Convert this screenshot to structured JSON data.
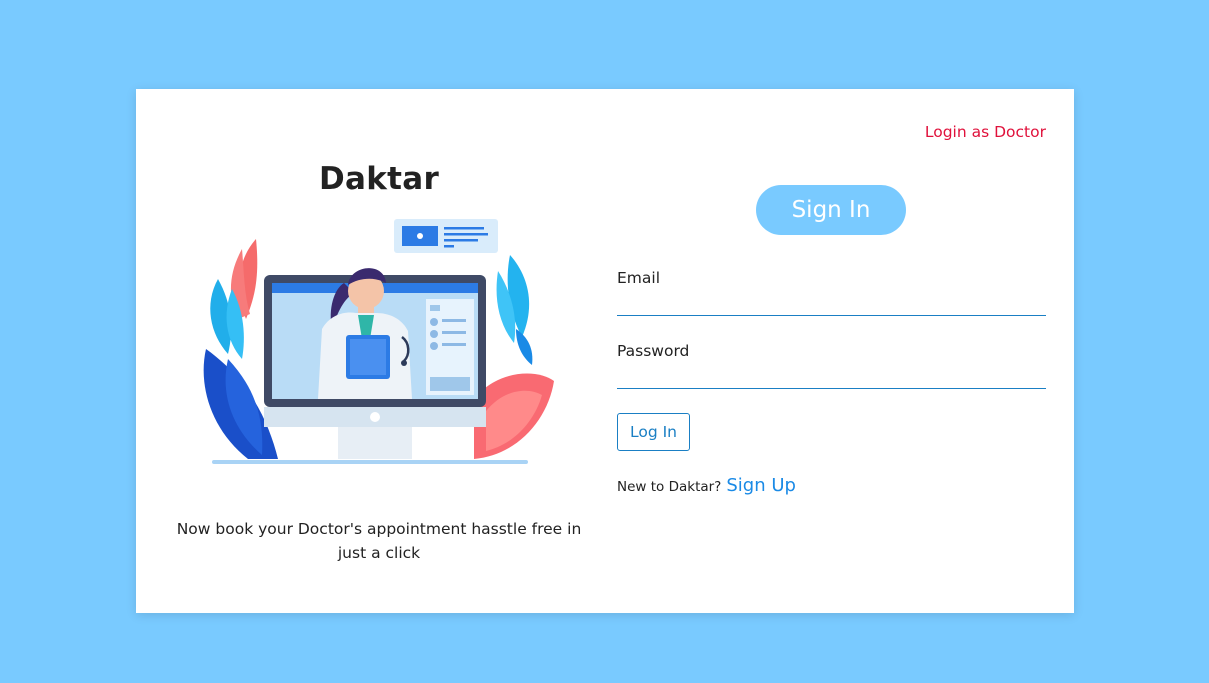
{
  "brand": {
    "name": "Daktar",
    "tagline": "Now book your Doctor's appointment hasstle free in just a click"
  },
  "header": {
    "doctor_login_label": "Login as Doctor"
  },
  "form": {
    "title": "Sign In",
    "email_label": "Email",
    "email_value": "",
    "password_label": "Password",
    "password_value": "",
    "submit_label": "Log In"
  },
  "signup": {
    "prompt": "New to Daktar?",
    "link_label": "Sign Up"
  },
  "colors": {
    "background": "#79caff",
    "accent_blue": "#1a7fc4",
    "doctor_link_red": "#e0113b",
    "pill": "#79caff"
  },
  "illustration": {
    "icon": "doctor-telemedicine-illustration"
  }
}
